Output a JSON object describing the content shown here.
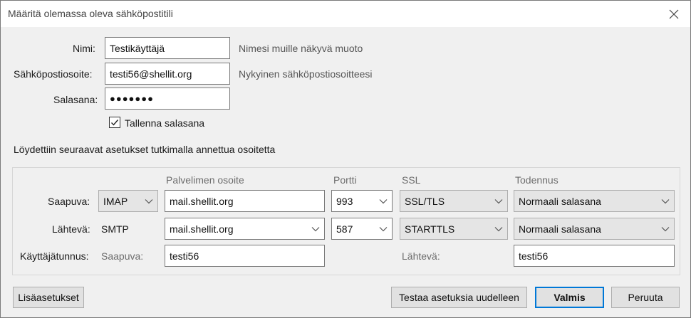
{
  "window": {
    "title": "Määritä olemassa oleva sähköpostitili"
  },
  "colors": {
    "accent": "#0078d7",
    "window_bg": "#f0f0f0"
  },
  "icons": {
    "close": "close-icon",
    "dropdown": "chevron-down-icon",
    "check": "checkmark-icon"
  },
  "identity": {
    "name_label": "Nimi:",
    "name_value": "Testikäyttäjä",
    "name_hint": "Nimesi muille näkyvä muoto",
    "email_label": "Sähköpostiosoite:",
    "email_value": "testi56@shellit.org",
    "email_hint": "Nykyinen sähköpostiosoitteesi",
    "password_label": "Salasana:",
    "password_value": "●●●●●●●",
    "remember_label": "Tallenna salasana",
    "remember_checked": true
  },
  "found_text": "Löydettiin seuraavat asetukset tutkimalla annettua osoitetta",
  "settings": {
    "headers": {
      "server": "Palvelimen osoite",
      "port": "Portti",
      "ssl": "SSL",
      "auth": "Todennus"
    },
    "incoming": {
      "label": "Saapuva:",
      "protocol": "IMAP",
      "server": "mail.shellit.org",
      "port": "993",
      "ssl": "SSL/TLS",
      "auth": "Normaali salasana"
    },
    "outgoing": {
      "label": "Lähtevä:",
      "protocol": "SMTP",
      "server": "mail.shellit.org",
      "port": "587",
      "ssl": "STARTTLS",
      "auth": "Normaali salasana"
    },
    "username": {
      "label": "Käyttäjätunnus:",
      "incoming_label": "Saapuva:",
      "incoming_value": "testi56",
      "outgoing_label": "Lähtevä:",
      "outgoing_value": "testi56"
    }
  },
  "buttons": {
    "advanced": "Lisäasetukset",
    "retest": "Testaa asetuksia uudelleen",
    "done": "Valmis",
    "cancel": "Peruuta"
  }
}
